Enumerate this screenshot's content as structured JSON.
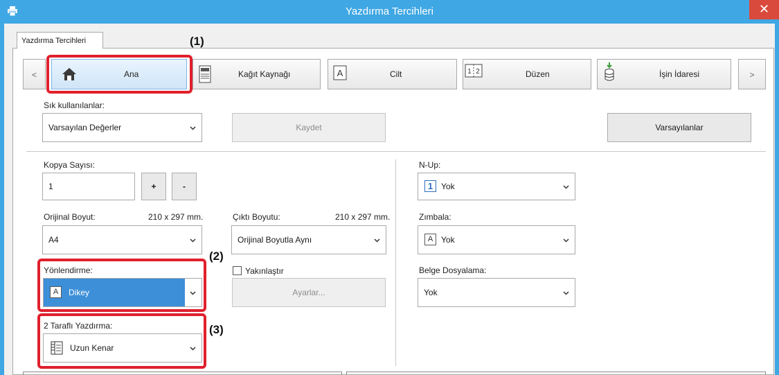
{
  "window": {
    "title": "Yazdırma Tercihleri",
    "close": "✕"
  },
  "tab": {
    "label": "Yazdırma Tercihleri"
  },
  "nav": {
    "prev": "<",
    "next": ">",
    "items": [
      {
        "label": "Ana",
        "icon": "home-icon"
      },
      {
        "label": "Kağıt Kaynağı",
        "icon": "paper-tray-icon"
      },
      {
        "label": "Cilt",
        "icon": "binding-icon"
      },
      {
        "label": "Düzen",
        "icon": "layout-icon"
      },
      {
        "label": "İşin İdaresi",
        "icon": "job-management-icon"
      }
    ]
  },
  "callouts": {
    "c1": "(1)",
    "c2": "(2)",
    "c3": "(3)"
  },
  "favorites": {
    "label": "Sık kullanılanlar:",
    "value": "Varsayılan Değerler",
    "save": "Kaydet",
    "defaults": "Varsayılanlar"
  },
  "copies": {
    "label": "Kopya Sayısı:",
    "value": "1",
    "plus": "+",
    "minus": "-"
  },
  "original_size": {
    "label": "Orijinal Boyut:",
    "dims": "210 x 297 mm.",
    "value": "A4"
  },
  "output_size": {
    "label": "Çıktı Boyutu:",
    "dims": "210 x 297 mm.",
    "value": "Orijinal Boyutla Aynı"
  },
  "orientation": {
    "label": "Yönlendirme:",
    "value": "Dikey",
    "icon_letter": "A"
  },
  "zoom": {
    "label": "Yakınlaştır",
    "settings": "Ayarlar..."
  },
  "duplex": {
    "label": "2 Taraflı Yazdırma:",
    "value": "Uzun Kenar"
  },
  "nup": {
    "label": "N-Up:",
    "value": "Yok",
    "icon_digit": "1"
  },
  "staple": {
    "label": "Zımbala:",
    "value": "Yok",
    "icon_letter": "A"
  },
  "filing": {
    "label": "Belge Dosyalama:",
    "value": "Yok"
  },
  "colors": {
    "accent": "#3fa7e4",
    "highlight": "#e0202d",
    "selected": "#3d8fd8"
  }
}
